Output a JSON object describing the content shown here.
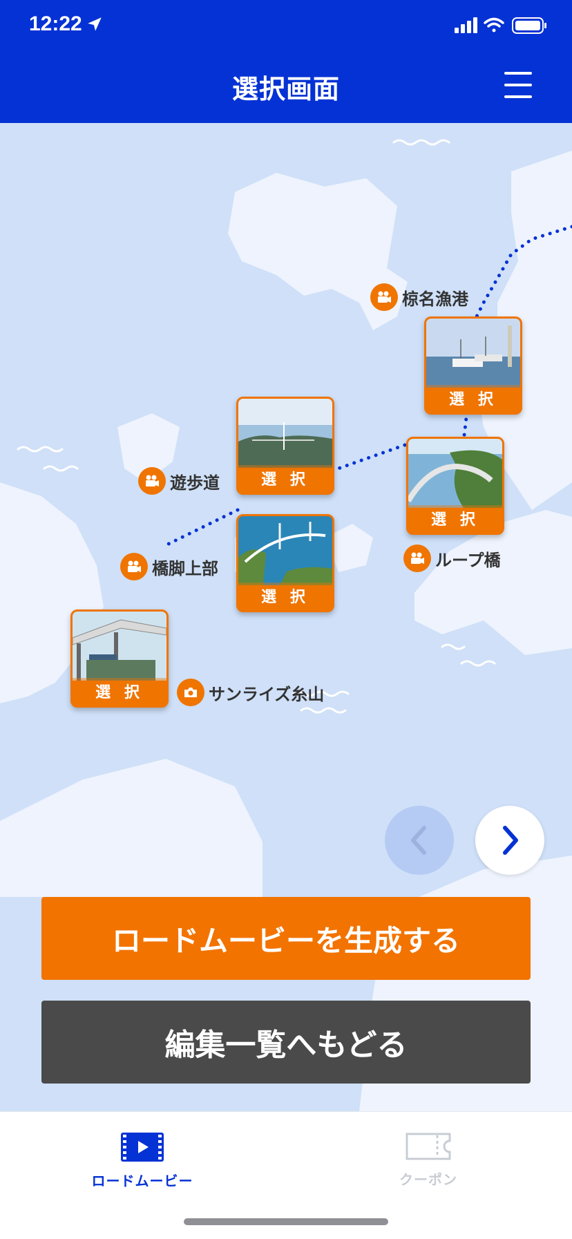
{
  "status_bar": {
    "time": "12:22"
  },
  "header": {
    "title": "選択画面"
  },
  "map": {
    "select_label": "選 択",
    "spots": [
      {
        "name": "椋名漁港",
        "icon": "video-camera-icon"
      },
      {
        "name": "ループ橋",
        "icon": "video-camera-icon"
      },
      {
        "name": "遊歩道",
        "icon": "video-camera-icon"
      },
      {
        "name": "橋脚上部",
        "icon": "video-camera-icon"
      },
      {
        "name": "サンライズ糸山",
        "icon": "camera-icon"
      }
    ]
  },
  "actions": {
    "generate_label": "ロードムービーを生成する",
    "back_label": "編集一覧へもどる"
  },
  "tabbar": {
    "tabs": [
      {
        "label": "ロードムービー",
        "icon": "film-icon",
        "active": true
      },
      {
        "label": "クーポン",
        "icon": "ticket-icon",
        "active": false
      }
    ]
  },
  "colors": {
    "primary": "#0532d4",
    "accent": "#f27300",
    "dark": "#4a4a4a",
    "sea": "#cfe0f8",
    "land": "#eef3fd"
  }
}
